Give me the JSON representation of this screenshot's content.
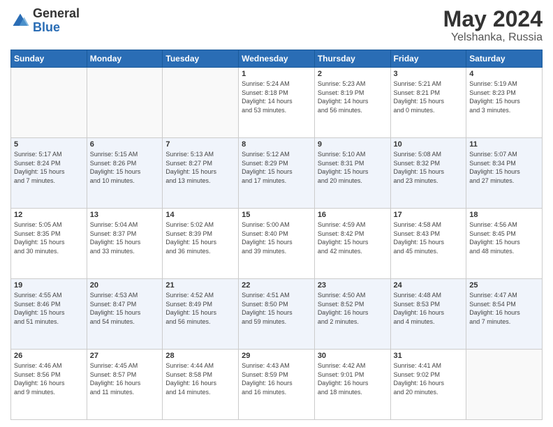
{
  "header": {
    "logo_line1": "General",
    "logo_line2": "Blue",
    "month_year": "May 2024",
    "location": "Yelshanka, Russia"
  },
  "days_of_week": [
    "Sunday",
    "Monday",
    "Tuesday",
    "Wednesday",
    "Thursday",
    "Friday",
    "Saturday"
  ],
  "weeks": [
    [
      {
        "day": "",
        "info": ""
      },
      {
        "day": "",
        "info": ""
      },
      {
        "day": "",
        "info": ""
      },
      {
        "day": "1",
        "info": "Sunrise: 5:24 AM\nSunset: 8:18 PM\nDaylight: 14 hours\nand 53 minutes."
      },
      {
        "day": "2",
        "info": "Sunrise: 5:23 AM\nSunset: 8:19 PM\nDaylight: 14 hours\nand 56 minutes."
      },
      {
        "day": "3",
        "info": "Sunrise: 5:21 AM\nSunset: 8:21 PM\nDaylight: 15 hours\nand 0 minutes."
      },
      {
        "day": "4",
        "info": "Sunrise: 5:19 AM\nSunset: 8:23 PM\nDaylight: 15 hours\nand 3 minutes."
      }
    ],
    [
      {
        "day": "5",
        "info": "Sunrise: 5:17 AM\nSunset: 8:24 PM\nDaylight: 15 hours\nand 7 minutes."
      },
      {
        "day": "6",
        "info": "Sunrise: 5:15 AM\nSunset: 8:26 PM\nDaylight: 15 hours\nand 10 minutes."
      },
      {
        "day": "7",
        "info": "Sunrise: 5:13 AM\nSunset: 8:27 PM\nDaylight: 15 hours\nand 13 minutes."
      },
      {
        "day": "8",
        "info": "Sunrise: 5:12 AM\nSunset: 8:29 PM\nDaylight: 15 hours\nand 17 minutes."
      },
      {
        "day": "9",
        "info": "Sunrise: 5:10 AM\nSunset: 8:31 PM\nDaylight: 15 hours\nand 20 minutes."
      },
      {
        "day": "10",
        "info": "Sunrise: 5:08 AM\nSunset: 8:32 PM\nDaylight: 15 hours\nand 23 minutes."
      },
      {
        "day": "11",
        "info": "Sunrise: 5:07 AM\nSunset: 8:34 PM\nDaylight: 15 hours\nand 27 minutes."
      }
    ],
    [
      {
        "day": "12",
        "info": "Sunrise: 5:05 AM\nSunset: 8:35 PM\nDaylight: 15 hours\nand 30 minutes."
      },
      {
        "day": "13",
        "info": "Sunrise: 5:04 AM\nSunset: 8:37 PM\nDaylight: 15 hours\nand 33 minutes."
      },
      {
        "day": "14",
        "info": "Sunrise: 5:02 AM\nSunset: 8:39 PM\nDaylight: 15 hours\nand 36 minutes."
      },
      {
        "day": "15",
        "info": "Sunrise: 5:00 AM\nSunset: 8:40 PM\nDaylight: 15 hours\nand 39 minutes."
      },
      {
        "day": "16",
        "info": "Sunrise: 4:59 AM\nSunset: 8:42 PM\nDaylight: 15 hours\nand 42 minutes."
      },
      {
        "day": "17",
        "info": "Sunrise: 4:58 AM\nSunset: 8:43 PM\nDaylight: 15 hours\nand 45 minutes."
      },
      {
        "day": "18",
        "info": "Sunrise: 4:56 AM\nSunset: 8:45 PM\nDaylight: 15 hours\nand 48 minutes."
      }
    ],
    [
      {
        "day": "19",
        "info": "Sunrise: 4:55 AM\nSunset: 8:46 PM\nDaylight: 15 hours\nand 51 minutes."
      },
      {
        "day": "20",
        "info": "Sunrise: 4:53 AM\nSunset: 8:47 PM\nDaylight: 15 hours\nand 54 minutes."
      },
      {
        "day": "21",
        "info": "Sunrise: 4:52 AM\nSunset: 8:49 PM\nDaylight: 15 hours\nand 56 minutes."
      },
      {
        "day": "22",
        "info": "Sunrise: 4:51 AM\nSunset: 8:50 PM\nDaylight: 15 hours\nand 59 minutes."
      },
      {
        "day": "23",
        "info": "Sunrise: 4:50 AM\nSunset: 8:52 PM\nDaylight: 16 hours\nand 2 minutes."
      },
      {
        "day": "24",
        "info": "Sunrise: 4:48 AM\nSunset: 8:53 PM\nDaylight: 16 hours\nand 4 minutes."
      },
      {
        "day": "25",
        "info": "Sunrise: 4:47 AM\nSunset: 8:54 PM\nDaylight: 16 hours\nand 7 minutes."
      }
    ],
    [
      {
        "day": "26",
        "info": "Sunrise: 4:46 AM\nSunset: 8:56 PM\nDaylight: 16 hours\nand 9 minutes."
      },
      {
        "day": "27",
        "info": "Sunrise: 4:45 AM\nSunset: 8:57 PM\nDaylight: 16 hours\nand 11 minutes."
      },
      {
        "day": "28",
        "info": "Sunrise: 4:44 AM\nSunset: 8:58 PM\nDaylight: 16 hours\nand 14 minutes."
      },
      {
        "day": "29",
        "info": "Sunrise: 4:43 AM\nSunset: 8:59 PM\nDaylight: 16 hours\nand 16 minutes."
      },
      {
        "day": "30",
        "info": "Sunrise: 4:42 AM\nSunset: 9:01 PM\nDaylight: 16 hours\nand 18 minutes."
      },
      {
        "day": "31",
        "info": "Sunrise: 4:41 AM\nSunset: 9:02 PM\nDaylight: 16 hours\nand 20 minutes."
      },
      {
        "day": "",
        "info": ""
      }
    ]
  ]
}
